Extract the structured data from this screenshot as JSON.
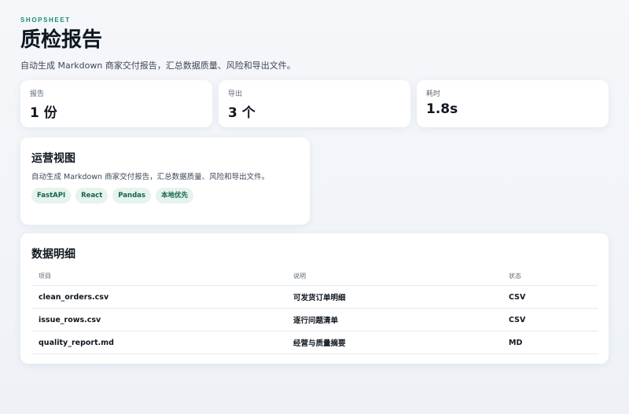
{
  "header": {
    "brand": "SHOPSHEET",
    "title": "质检报告",
    "subtitle": "自动生成 Markdown 商家交付报告，汇总数据质量、风险和导出文件。"
  },
  "stats": [
    {
      "label": "报告",
      "value": "1 份"
    },
    {
      "label": "导出",
      "value": "3 个"
    },
    {
      "label": "耗时",
      "value": "1.8s"
    }
  ],
  "overview": {
    "title": "运营视图",
    "description": "自动生成 Markdown 商家交付报告，汇总数据质量、风险和导出文件。",
    "tags": [
      "FastAPI",
      "React",
      "Pandas",
      "本地优先"
    ]
  },
  "details": {
    "title": "数据明细",
    "columns": [
      "项目",
      "说明",
      "状态"
    ],
    "rows": [
      {
        "item": "clean_orders.csv",
        "desc": "可发货订单明细",
        "status": "CSV"
      },
      {
        "item": "issue_rows.csv",
        "desc": "逐行问题清单",
        "status": "CSV"
      },
      {
        "item": "quality_report.md",
        "desc": "经营与质量摘要",
        "status": "MD"
      }
    ]
  }
}
